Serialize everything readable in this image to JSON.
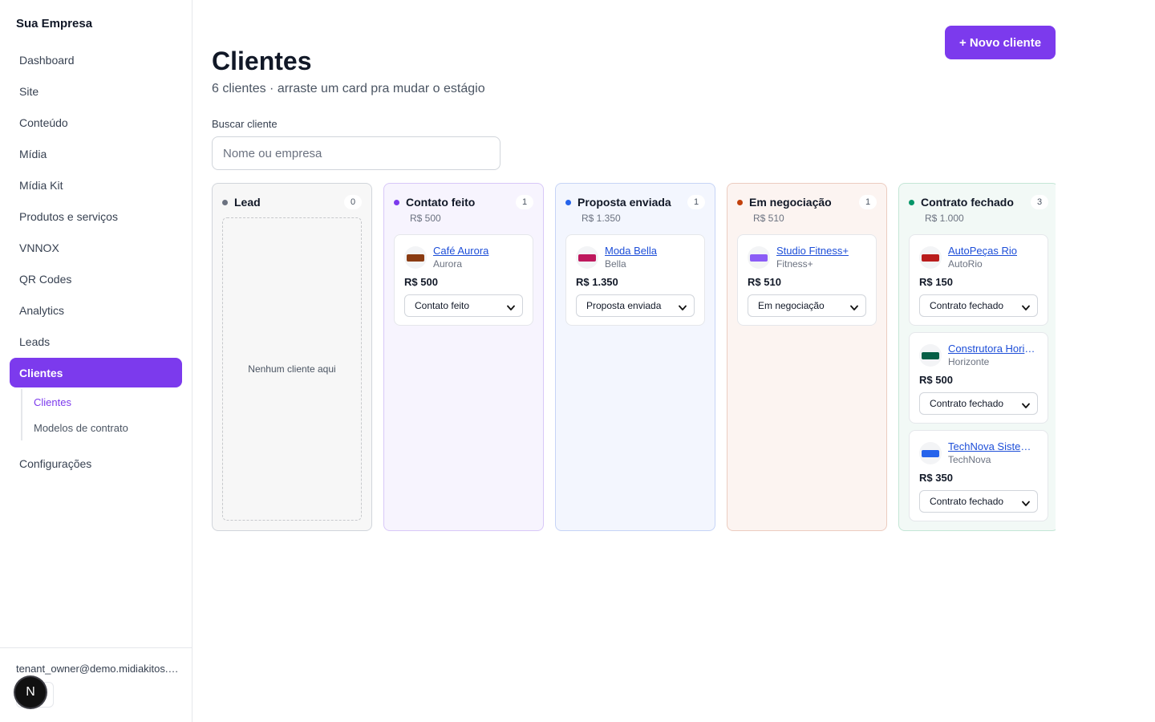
{
  "sidebar": {
    "brand": "Sua Empresa",
    "items": [
      {
        "label": "Dashboard"
      },
      {
        "label": "Site"
      },
      {
        "label": "Conteúdo"
      },
      {
        "label": "Mídia"
      },
      {
        "label": "Mídia Kit"
      },
      {
        "label": "Produtos e serviços"
      },
      {
        "label": "VNNOX"
      },
      {
        "label": "QR Codes"
      },
      {
        "label": "Analytics"
      },
      {
        "label": "Leads"
      },
      {
        "label": "Clientes"
      },
      {
        "label": "Configurações"
      }
    ],
    "subitems": [
      {
        "label": "Clientes"
      },
      {
        "label": "Modelos de contrato"
      }
    ],
    "user_email": "tenant_owner@demo.midiakitos.com",
    "dev_badge": "N"
  },
  "header": {
    "title": "Clientes",
    "subtitle": "6 clientes · arraste um card pra mudar o estágio",
    "new_button": "+ Novo cliente"
  },
  "search": {
    "label": "Buscar cliente",
    "placeholder": "Nome ou empresa",
    "value": ""
  },
  "board": {
    "empty_text": "Nenhum cliente aqui",
    "columns": [
      {
        "title": "Lead",
        "count": "0",
        "total": "",
        "dot_color": "#6b7280",
        "bg": "#f7f7f7",
        "border": "#d1d5db",
        "cards": []
      },
      {
        "title": "Contato feito",
        "count": "1",
        "total": "R$ 500",
        "dot_color": "#7c3aed",
        "bg": "#f7f4fe",
        "border": "#d8c8f8",
        "cards": [
          {
            "name": "Café Aurora",
            "company": "Aurora",
            "value": "R$ 500",
            "stage": "Contato feito",
            "logo_color": "#8a3b12"
          }
        ]
      },
      {
        "title": "Proposta enviada",
        "count": "1",
        "total": "R$ 1.350",
        "dot_color": "#2563eb",
        "bg": "#f3f6fe",
        "border": "#c6d4f6",
        "cards": [
          {
            "name": "Moda Bella",
            "company": "Bella",
            "value": "R$ 1.350",
            "stage": "Proposta enviada",
            "logo_color": "#be185d"
          }
        ]
      },
      {
        "title": "Em negociação",
        "count": "1",
        "total": "R$ 510",
        "dot_color": "#c2410c",
        "bg": "#fcf4f1",
        "border": "#ecccc0",
        "cards": [
          {
            "name": "Studio Fitness+",
            "company": "Fitness+",
            "value": "R$ 510",
            "stage": "Em negociação",
            "logo_color": "#8b5cf6"
          }
        ]
      },
      {
        "title": "Contrato fechado",
        "count": "3",
        "total": "R$ 1.000",
        "dot_color": "#059669",
        "bg": "#f2f9f6",
        "border": "#c4e6d6",
        "cards": [
          {
            "name": "AutoPeças Rio",
            "company": "AutoRio",
            "value": "R$ 150",
            "stage": "Contrato fechado",
            "logo_color": "#b91c1c"
          },
          {
            "name": "Construtora Horizonte",
            "company": "Horizonte",
            "value": "R$ 500",
            "stage": "Contrato fechado",
            "logo_color": "#065f46"
          },
          {
            "name": "TechNova Sistemas",
            "company": "TechNova",
            "value": "R$ 350",
            "stage": "Contrato fechado",
            "logo_color": "#2563eb"
          }
        ]
      }
    ]
  }
}
